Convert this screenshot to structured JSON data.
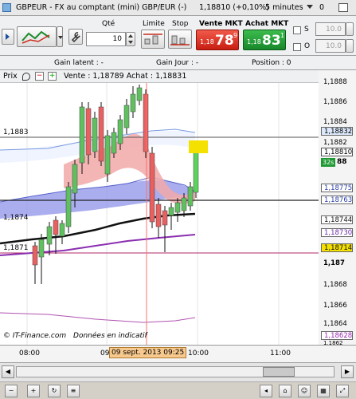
{
  "title_bar": {
    "instrument": "GBPEUR - FX au comptant (mini) GBP/EUR (-)",
    "last": "1,18810 (+0,10%)",
    "period": "5 minutes",
    "extra": "0"
  },
  "toolbar": {
    "qty_label": "Qté",
    "qty_value": "10",
    "limit_label": "Limite",
    "stop_label": "Stop",
    "sell_label": "Vente MKT",
    "sell_price_prefix": "1,18",
    "sell_price_big": "78",
    "sell_price_sup": "9",
    "buy_label": "Achat MKT",
    "buy_price_prefix": "1,18",
    "buy_price_big": "83",
    "buy_price_sup": "1",
    "s_label": "S",
    "o_label": "O",
    "s_value": "10.0",
    "o_value": "10.0"
  },
  "gain_bar": {
    "latent": "Gain latent : -",
    "jour": "Gain Jour : -",
    "position": "Position : 0"
  },
  "chart": {
    "price_label": "Prix",
    "quote_info": "Vente : 1,18789 Achat : 1,18831",
    "level_1883": "1,1883",
    "level_18744": "1,1874",
    "level_18714": "1,1871",
    "watermark": "© IT-Finance.com",
    "data_notice": "Données en indicatif",
    "time_0800": "08:00",
    "time_cursor": "09 sept. 2013 09:25",
    "time_1000": "10:00",
    "time_1100": "11:00",
    "time_09": "09"
  },
  "y_axis": {
    "ticks": [
      "1,1888",
      "1,1886",
      "1,1884",
      "1,1882",
      "1,187",
      "1,1868",
      "1,1866",
      "1,1864",
      "1,1862"
    ],
    "tick_1888": "1,1888",
    "tick_1886": "1,1886",
    "tick_1884": "1,1884",
    "tick_1882": "1,1882",
    "tick_1870": "1,187",
    "tick_1868": "1,1868",
    "tick_1866": "1,1866",
    "tick_1864": "1,1864",
    "tick_1862": "1,1862",
    "box_18832": "1,18832",
    "box_18810": "1,18810",
    "box_countdown": "32s",
    "box_88": "88",
    "box_18775": "1,18775",
    "box_18763": "1,18763",
    "box_18744": "1,18744",
    "box_18730": "1,18730",
    "box_18714": "1,18714",
    "box_18628": "1,18628"
  },
  "colors": {
    "sell": "#d42a1c",
    "buy": "#1f9a33",
    "candle_up": "#5cc35c",
    "highlight": "#f5e100",
    "cursor_label": "#f7c98e"
  }
}
